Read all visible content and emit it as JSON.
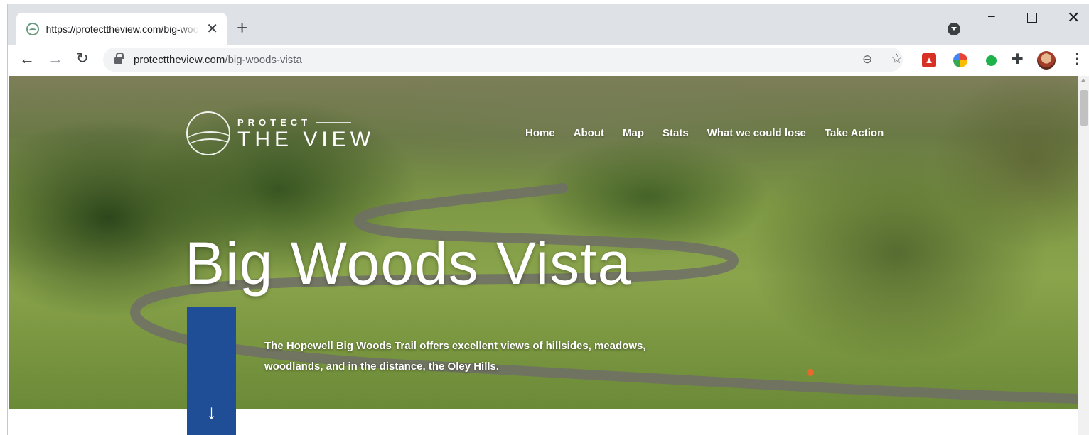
{
  "browser": {
    "tab_title": "https://protecttheview.com/big-woods-vista",
    "tab_close": "✕",
    "new_tab": "+",
    "window_min": "−",
    "window_close": "✕",
    "url_domain": "protecttheview.com",
    "url_path": "/big-woods-vista",
    "icons": [
      "back-icon",
      "forward-icon",
      "reload-icon",
      "lock-icon",
      "zoom-icon",
      "star-icon",
      "pdf-extension-icon",
      "color-extension-icon",
      "green-dot-extension-icon",
      "puzzle-icon",
      "profile-avatar",
      "menu-icon"
    ]
  },
  "site": {
    "logo_top": "PROTECT",
    "logo_bottom": "THE VIEW",
    "nav": [
      "Home",
      "About",
      "Map",
      "Stats",
      "What we could lose",
      "Take Action"
    ],
    "title": "Big Woods Vista",
    "description": "The Hopewell Big Woods Trail offers excellent views of hillsides, meadows, woodlands, and in the distance, the Oley Hills.",
    "scroll_arrow": "↓",
    "accent_color": "#1f4e96"
  }
}
